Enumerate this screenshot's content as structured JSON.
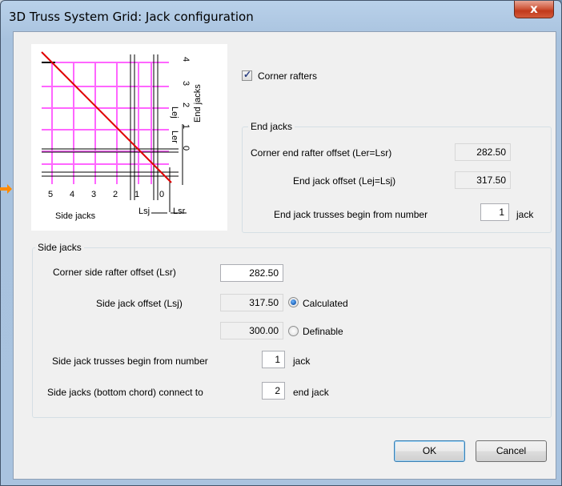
{
  "window": {
    "title": "3D Truss System Grid: Jack configuration",
    "close_label": "x"
  },
  "diagram": {
    "end_ticks": [
      "4",
      "3",
      "2",
      "1",
      "0"
    ],
    "side_ticks": [
      "5",
      "4",
      "3",
      "2",
      "1",
      "0"
    ],
    "lej_label": "Lej",
    "ler_label": "Ler",
    "lsj_label": "Lsj",
    "lsr_label": "Lsr",
    "end_jacks_label": "End jacks",
    "side_jacks_label": "Side jacks",
    "colors": {
      "grid": "#ff66ff",
      "rafter": "#e00000",
      "lines": "#000000"
    }
  },
  "corner_rafters": {
    "label": "Corner rafters",
    "checked": true
  },
  "end_jacks": {
    "title": "End jacks",
    "corner_offset_label": "Corner end rafter offset (Ler=Lsr)",
    "corner_offset_value": "282.50",
    "jack_offset_label": "End jack offset (Lej=Lsj)",
    "jack_offset_value": "317.50",
    "begin_label": "End jack trusses begin from number",
    "begin_value": "1",
    "begin_suffix": "jack"
  },
  "side_jacks": {
    "title": "Side jacks",
    "corner_offset_label": "Corner side rafter offset (Lsr)",
    "corner_offset_value": "282.50",
    "jack_offset_label": "Side jack offset (Lsj)",
    "calculated_value": "317.50",
    "calculated_label": "Calculated",
    "definable_value": "300.00",
    "definable_label": "Definable",
    "begin_label": "Side jack trusses begin from number",
    "begin_value": "1",
    "begin_suffix": "jack",
    "connect_label": "Side jacks (bottom chord) connect to",
    "connect_value": "2",
    "connect_suffix": "end jack"
  },
  "buttons": {
    "ok": "OK",
    "cancel": "Cancel"
  }
}
